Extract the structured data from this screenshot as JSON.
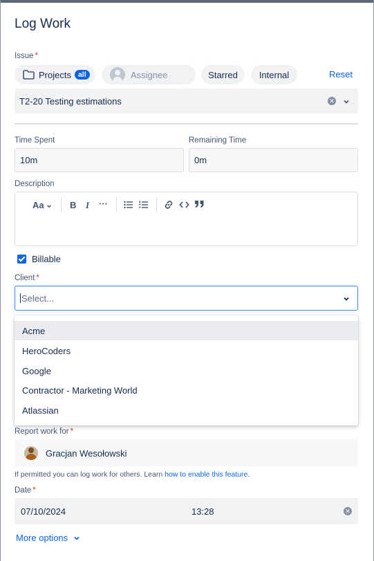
{
  "dialog": {
    "title": "Log Work"
  },
  "issue": {
    "label": "Issue",
    "filters": {
      "projects_label": "Projects",
      "projects_badge": "all",
      "assignee_placeholder": "Assignee",
      "starred_label": "Starred",
      "internal_label": "Internal",
      "reset_label": "Reset"
    },
    "value": "T2-20 Testing estimations"
  },
  "time": {
    "spent_label": "Time Spent",
    "spent_value": "10m",
    "remaining_label": "Remaining Time",
    "remaining_value": "0m"
  },
  "description": {
    "label": "Description",
    "toolbar": {
      "text_style": "Aa",
      "bold": "B",
      "italic": "I",
      "more": "···"
    }
  },
  "billable": {
    "label": "Billable",
    "checked": true
  },
  "client": {
    "label": "Client",
    "placeholder": "Select...",
    "options": [
      "Acme",
      "HeroCoders",
      "Google",
      "Contractor - Marketing World",
      "Atlassian"
    ],
    "highlighted_index": 0
  },
  "report_for": {
    "label": "Report work for",
    "user": "Gracjan Wesołowski",
    "hint_prefix": "If permitted you can log work for others. Learn ",
    "hint_link": "how to enable this feature."
  },
  "date": {
    "label": "Date",
    "date_value": "07/10/2024",
    "time_value": "13:28"
  },
  "more_options": {
    "label": "More options"
  },
  "colors": {
    "primary": "#0c66e4",
    "required": "#de350b",
    "text": "#172b4d",
    "focus_border": "#388bff"
  }
}
